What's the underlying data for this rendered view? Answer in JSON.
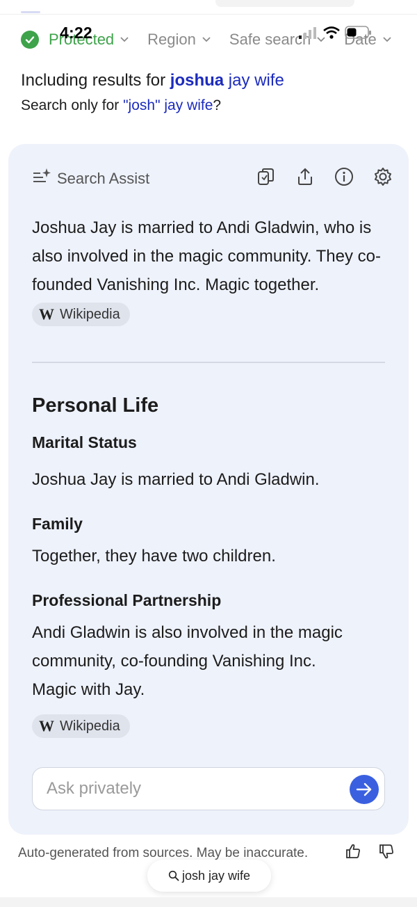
{
  "status": {
    "time": "4:22"
  },
  "filters": [
    {
      "label": "Protected"
    },
    {
      "label": "Region"
    },
    {
      "label": "Safe search"
    },
    {
      "label": "Date"
    }
  ],
  "results_for": {
    "prefix": "Including results for",
    "query_bold": "joshua",
    "query_rest": "jay wife",
    "search_only_prefix": "Search only for",
    "search_only_query": "\"josh\" jay wife",
    "search_only_suffix": "?"
  },
  "assist": {
    "title": "Search Assist",
    "summary": "Joshua Jay is married to Andi Gladwin, who is also involved in the magic community. They co-founded Vanishing Inc. Magic together.",
    "source_label": "Wikipedia",
    "section_title": "Personal Life",
    "marital_title": "Marital Status",
    "marital_text": "Joshua Jay is married to Andi Gladwin.",
    "family_title": "Family",
    "family_text": "Together, they have two children.",
    "partner_title": "Professional Partnership",
    "partner_text": "Andi Gladwin is also involved in the magic community, co-founding Vanishing Inc. Magic with Jay.",
    "source_label_2": "Wikipedia",
    "ask_placeholder": "Ask privately"
  },
  "footer": {
    "note": "Auto-generated from sources. May be inaccurate.",
    "query": "josh jay wife"
  },
  "colors": {
    "accent": "#3a60e0",
    "link": "#1c2bbd",
    "protected": "#3ea34a",
    "card_bg": "#eef2fb"
  }
}
